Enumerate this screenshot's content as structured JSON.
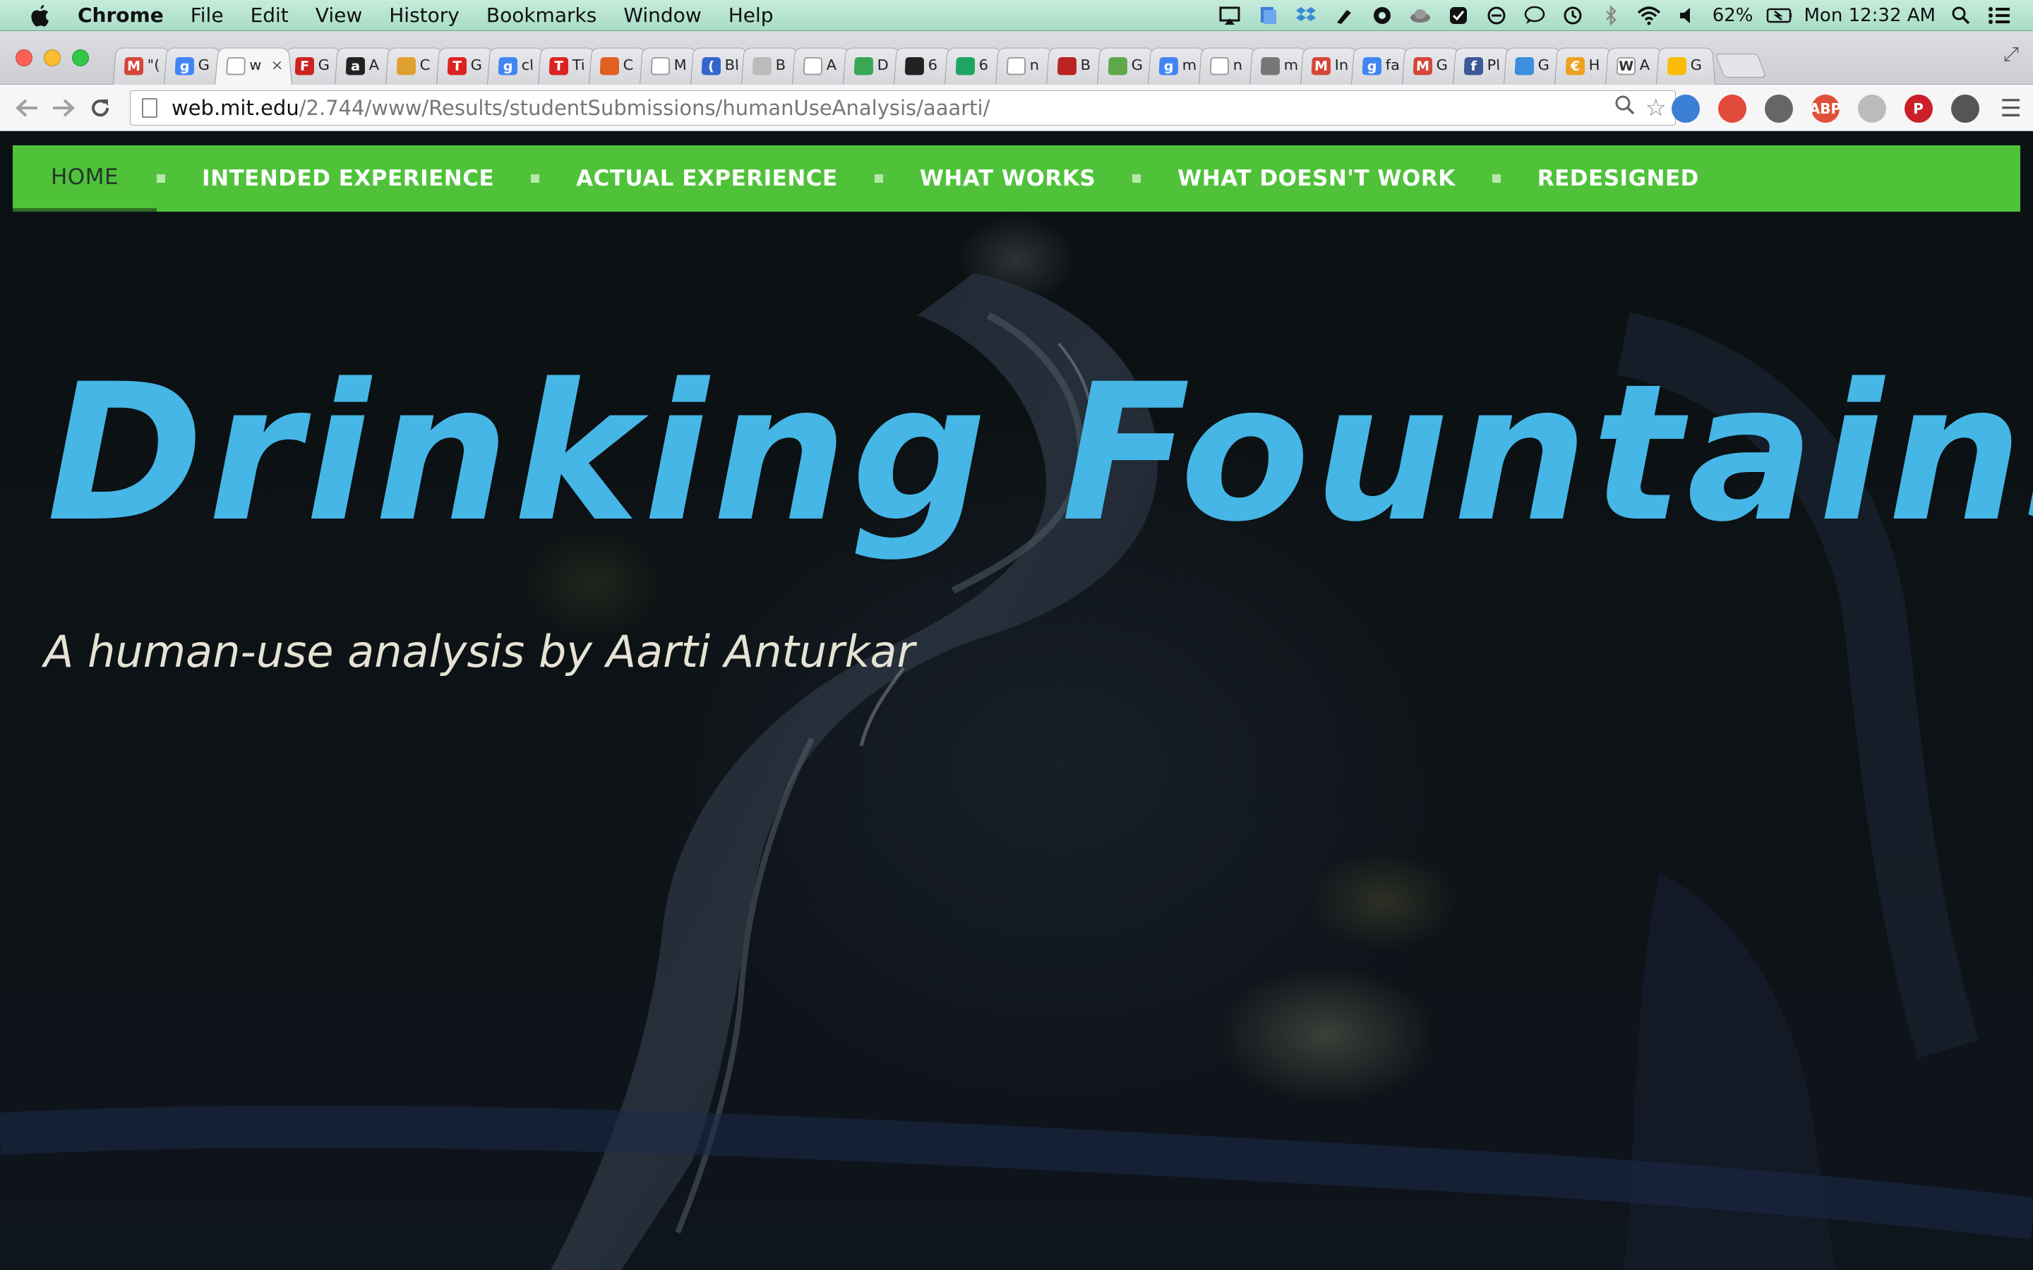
{
  "menubar": {
    "app_name": "Chrome",
    "items": [
      "File",
      "Edit",
      "View",
      "History",
      "Bookmarks",
      "Window",
      "Help"
    ],
    "battery": "62%",
    "clock": "Mon 12:32 AM"
  },
  "tabs": [
    {
      "favicon": "gmail",
      "color": "#d44638",
      "glyph": "M",
      "label": "\"("
    },
    {
      "favicon": "google",
      "color": "#4285f4",
      "glyph": "g",
      "label": "G"
    },
    {
      "favicon": "page",
      "color": "#ffffff",
      "glyph": "",
      "label": "w",
      "active": true,
      "close": "×"
    },
    {
      "favicon": "flash",
      "color": "#cc2222",
      "glyph": "F",
      "label": "G"
    },
    {
      "favicon": "amazon",
      "color": "#222222",
      "glyph": "a",
      "label": "A"
    },
    {
      "favicon": "chrome-store",
      "color": "#e0a030",
      "glyph": "",
      "label": "C"
    },
    {
      "favicon": "t-red",
      "color": "#d22",
      "glyph": "T",
      "label": "G"
    },
    {
      "favicon": "google",
      "color": "#4285f4",
      "glyph": "g",
      "label": "cl"
    },
    {
      "favicon": "t-red",
      "color": "#d22",
      "glyph": "T",
      "label": "Ti"
    },
    {
      "favicon": "picasa",
      "color": "#e06020",
      "glyph": "",
      "label": "C"
    },
    {
      "favicon": "page",
      "color": "#ffffff",
      "glyph": "",
      "label": "M"
    },
    {
      "favicon": "crescent",
      "color": "#3366cc",
      "glyph": "(",
      "label": "Bl"
    },
    {
      "favicon": "gear",
      "color": "#bbbbbb",
      "glyph": "",
      "label": "B"
    },
    {
      "favicon": "page",
      "color": "#ffffff",
      "glyph": "",
      "label": "A"
    },
    {
      "favicon": "chrome",
      "color": "#3aa757",
      "glyph": "",
      "label": "D"
    },
    {
      "favicon": "swirl",
      "color": "#222222",
      "glyph": "",
      "label": "6"
    },
    {
      "favicon": "drive",
      "color": "#1fa463",
      "glyph": "",
      "label": "6"
    },
    {
      "favicon": "page",
      "color": "#ffffff",
      "glyph": "",
      "label": "n"
    },
    {
      "favicon": "mojo",
      "color": "#b22",
      "glyph": "",
      "label": "B"
    },
    {
      "favicon": "maps",
      "color": "#5fa84a",
      "glyph": "",
      "label": "G"
    },
    {
      "favicon": "google",
      "color": "#4285f4",
      "glyph": "g",
      "label": "m"
    },
    {
      "favicon": "page",
      "color": "#ffffff",
      "glyph": "",
      "label": "n"
    },
    {
      "favicon": "math",
      "color": "#777777",
      "glyph": "",
      "label": "m"
    },
    {
      "favicon": "gmail",
      "color": "#d44638",
      "glyph": "M",
      "label": "In"
    },
    {
      "favicon": "google",
      "color": "#4285f4",
      "glyph": "g",
      "label": "fa"
    },
    {
      "favicon": "gmail",
      "color": "#d44638",
      "glyph": "M",
      "label": "G"
    },
    {
      "favicon": "facebook",
      "color": "#3b5998",
      "glyph": "f",
      "label": "Pl"
    },
    {
      "favicon": "doc",
      "color": "#3c8ede",
      "glyph": "",
      "label": "G"
    },
    {
      "favicon": "coin",
      "color": "#f0a020",
      "glyph": "€",
      "label": "H"
    },
    {
      "favicon": "wikipedia",
      "color": "#ffffff",
      "glyph": "W",
      "label": "A"
    },
    {
      "favicon": "google-mixed",
      "color": "#fbbc05",
      "glyph": "",
      "label": "G"
    }
  ],
  "toolbar": {
    "url_host": "web.mit.edu",
    "url_path": "/2.744/www/Results/studentSubmissions/humanUseAnalysis/aaarti/"
  },
  "extensions": [
    {
      "name": "clock-ext",
      "color": "#3b7fd4",
      "glyph": ""
    },
    {
      "name": "stop-ext",
      "color": "#e24a3b",
      "glyph": ""
    },
    {
      "name": "cast-ext",
      "color": "#666666",
      "glyph": ""
    },
    {
      "name": "adblock-ext",
      "color": "#e0503a",
      "glyph": "ABP"
    },
    {
      "name": "globe-ext",
      "color": "#bbbbbb",
      "glyph": ""
    },
    {
      "name": "pinterest-ext",
      "color": "#cb2027",
      "glyph": "P"
    },
    {
      "name": "wrench-ext",
      "color": "#555555",
      "glyph": ""
    }
  ],
  "site": {
    "nav": [
      {
        "label": "HOME",
        "active": true
      },
      {
        "label": "INTENDED EXPERIENCE"
      },
      {
        "label": "ACTUAL EXPERIENCE"
      },
      {
        "label": "WHAT WORKS"
      },
      {
        "label": "WHAT DOESN'T WORK"
      },
      {
        "label": "REDESIGNED"
      }
    ],
    "title": "Drinking Fountains",
    "subtitle": "A human-use analysis by Aarti Anturkar",
    "nav_color": "#4fc23a",
    "title_color": "#45b6e6"
  }
}
